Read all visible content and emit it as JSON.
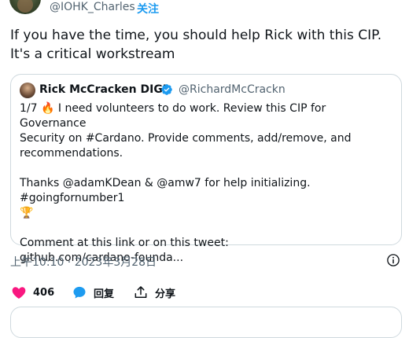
{
  "author": {
    "handle": "@IOHK_Charles",
    "follow_label": "关注"
  },
  "tweet": {
    "text_line1": "If you have the time, you should help Rick with this CIP.",
    "text_line2": "It's a critical workstream"
  },
  "quoted": {
    "name": "Rick McCracken DIGI",
    "handle": "@RichardMcCrackn",
    "line1": "1/7 🔥 I need volunteers to do work. Review this CIP for Governance",
    "line2": "Security on #Cardano. Provide comments, add/remove, and",
    "line3": "recommendations.",
    "line4": "Thanks @adamKDean & @amw7 for help initializing. #goingfornumber1",
    "line5": "🏆",
    "line6": "Comment at this link or on this tweet:",
    "line7": "github.com/cardano-founda..."
  },
  "meta": {
    "timestamp": "上午10:10 · 2023年3月28日"
  },
  "actions": {
    "like_count": "406",
    "reply_label": "回复",
    "share_label": "分享"
  },
  "colors": {
    "accent": "#1d9bf0",
    "like": "#f91880",
    "text": "#0f1419",
    "muted": "#536471",
    "border": "#cfd9de"
  }
}
